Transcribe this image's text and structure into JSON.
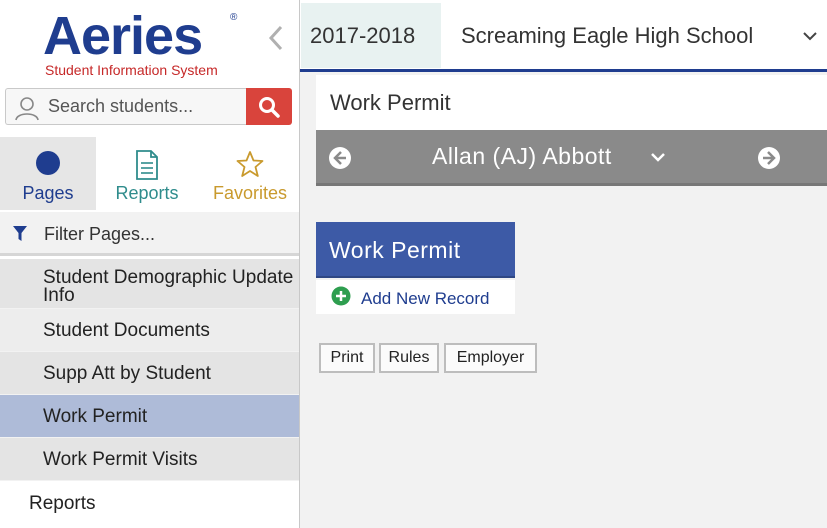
{
  "app": {
    "logo": {
      "word": "Aeries",
      "registered": "®",
      "tagline": "Student Information System"
    },
    "collapse_icon": "chevron-left-icon"
  },
  "search": {
    "placeholder": "Search students...",
    "icon": "user-icon",
    "button_icon": "search-icon"
  },
  "nav_tabs": [
    {
      "label": "Pages",
      "icon": "circle-icon",
      "color": "#1f3d8f",
      "selected": true
    },
    {
      "label": "Reports",
      "icon": "document-icon",
      "color": "#2f8c8c"
    },
    {
      "label": "Favorites",
      "icon": "star-icon",
      "color": "#c99a2e"
    }
  ],
  "filter": {
    "placeholder": "Filter Pages...",
    "icon": "funnel-icon"
  },
  "pages": [
    {
      "label": "Student Demographic Update Info"
    },
    {
      "label": "Student Documents"
    },
    {
      "label": "Supp Att by Student"
    },
    {
      "label": "Work Permit",
      "active": true
    },
    {
      "label": "Work Permit Visits"
    }
  ],
  "reports_link": "Reports",
  "topbar": {
    "year": "2017-2018",
    "school": "Screaming Eagle High School",
    "accent": "#1f3d8f"
  },
  "main": {
    "page_title": "Work Permit",
    "student_name": "Allan (AJ) Abbott",
    "section_title": "Work Permit",
    "add_record": "Add New Record",
    "buttons": {
      "print": "Print",
      "rules": "Rules",
      "employer": "Employer"
    }
  },
  "colors": {
    "brand_blue": "#1f3d8f",
    "search_red": "#d9443c",
    "active_item": "#aebbd8",
    "section_header": "#3d5aa6",
    "student_bar": "#8a8a8a",
    "add_green": "#2e9e4f"
  }
}
